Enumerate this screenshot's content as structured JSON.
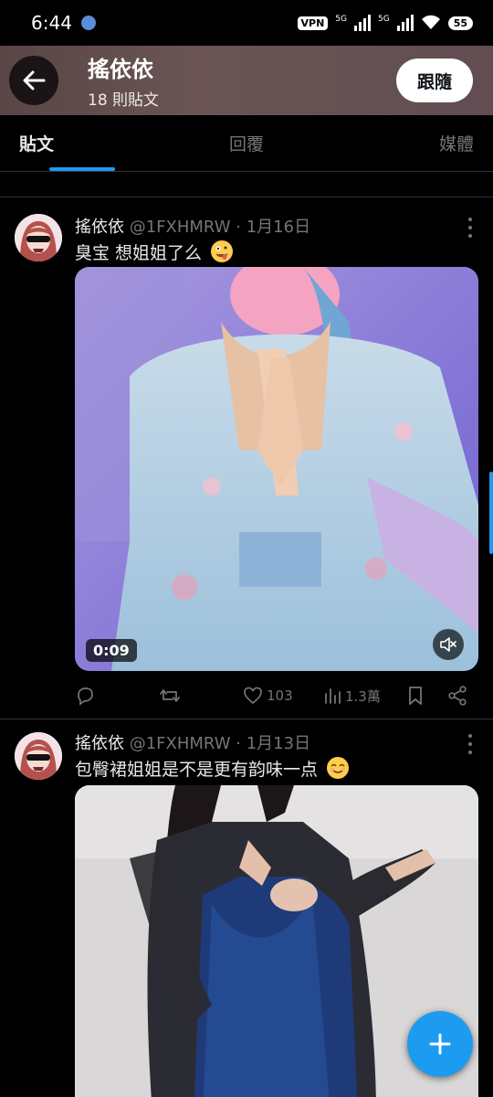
{
  "status_bar": {
    "time": "6:44",
    "vpn": "VPN",
    "net1": "5G",
    "net2": "5G",
    "battery": "55"
  },
  "header": {
    "name": "搖依依",
    "post_count": "18 則貼文",
    "follow_label": "跟隨",
    "back_icon": "arrow-left-icon"
  },
  "tabs": [
    {
      "label": "貼文",
      "active": true
    },
    {
      "label": "回覆",
      "active": false
    },
    {
      "label": "媒體",
      "active": false
    }
  ],
  "posts": [
    {
      "name": "搖依依",
      "handle": "@1FXHMRW",
      "separator": "·",
      "date": "1月16日",
      "text": "臭宝 想姐姐了么",
      "emoji": "zany-face-emoji",
      "video_duration": "0:09",
      "actions": {
        "reply": "",
        "repost": "",
        "likes": "103",
        "views": "1.3萬"
      }
    },
    {
      "name": "搖依依",
      "handle": "@1FXHMRW",
      "separator": "·",
      "date": "1月13日",
      "text": "包臀裙姐姐是不是更有韵味一点",
      "emoji": "smiling-face-emoji"
    }
  ],
  "colors": {
    "accent": "#1d9bf0",
    "background": "#000000",
    "muted_text": "#71767b",
    "primary_text": "#e7e9ea"
  }
}
